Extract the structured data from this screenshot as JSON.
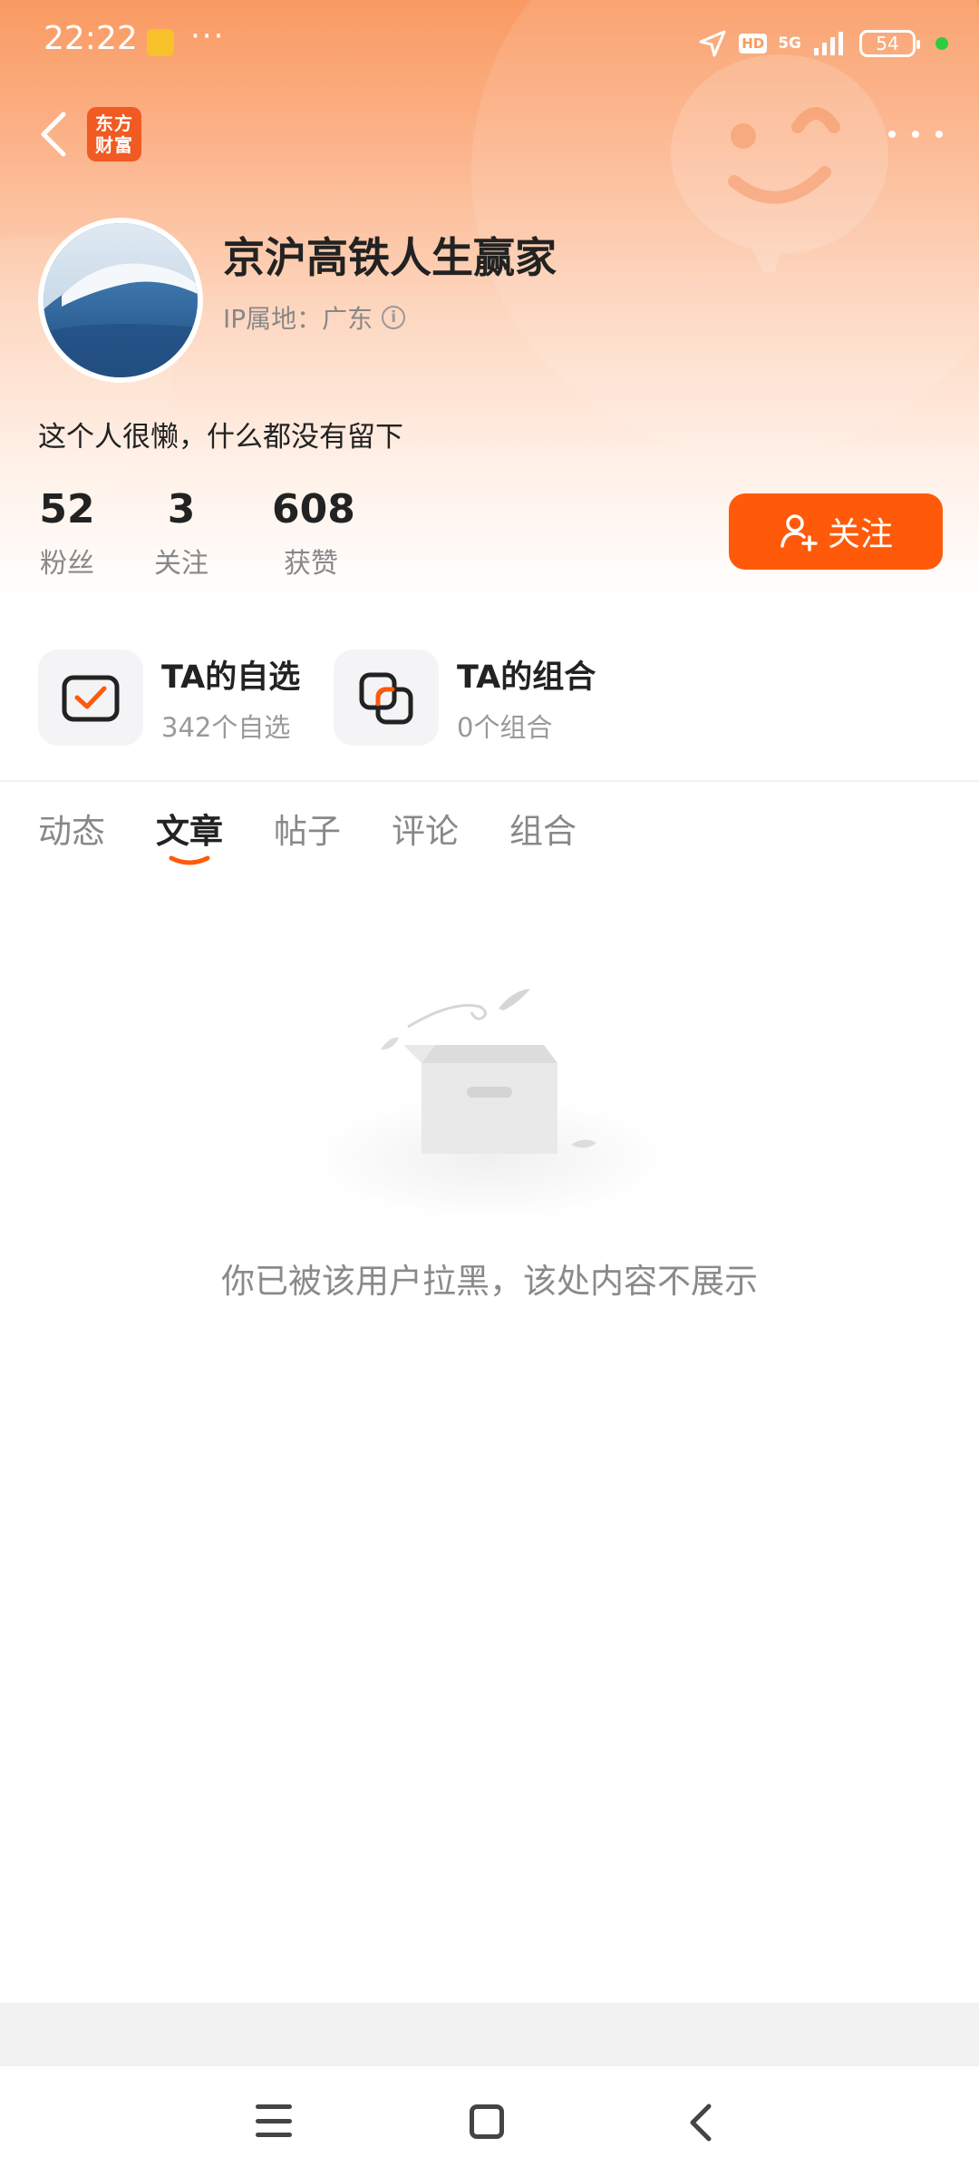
{
  "status_bar": {
    "time": "22:22",
    "more": "···",
    "hd": "HD",
    "network": "5G",
    "battery": "54"
  },
  "app": {
    "logo_text": "东方财富"
  },
  "profile": {
    "username": "京沪高铁人生赢家",
    "ip_location": "IP属地：广东",
    "bio": "这个人很懒，什么都没有留下",
    "stats": [
      {
        "value": "52",
        "label": "粉丝"
      },
      {
        "value": "3",
        "label": "关注"
      },
      {
        "value": "608",
        "label": "获赞"
      }
    ],
    "follow_label": "关注"
  },
  "features": {
    "watchlist": {
      "title": "TA的自选",
      "subtitle": "342个自选"
    },
    "portfolio": {
      "title": "TA的组合",
      "subtitle": "0个组合"
    }
  },
  "tabs": [
    {
      "label": "动态"
    },
    {
      "label": "文章"
    },
    {
      "label": "帖子"
    },
    {
      "label": "评论"
    },
    {
      "label": "组合"
    }
  ],
  "active_tab": "文章",
  "empty_state": {
    "message": "你已被该用户拉黑，该处内容不展示"
  },
  "colors": {
    "accent": "#ff5a0a",
    "header_gradient_top": "#f99a62"
  }
}
